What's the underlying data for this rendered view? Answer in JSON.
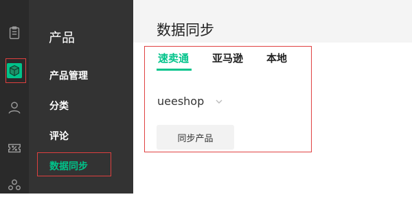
{
  "rail": {
    "icons": [
      "clipboard-icon",
      "cube-icon",
      "user-icon",
      "discount-icon",
      "people-icon"
    ],
    "active_icon": "cube-icon"
  },
  "sidebar": {
    "section_title": "产品",
    "items": [
      {
        "label": "产品管理"
      },
      {
        "label": "分类"
      },
      {
        "label": "评论"
      },
      {
        "label": "数据同步"
      }
    ]
  },
  "page": {
    "title": "数据同步",
    "tabs": [
      {
        "label": "速卖通"
      },
      {
        "label": "亚马逊"
      },
      {
        "label": "本地"
      }
    ],
    "store_select": {
      "value": "ueeshop"
    },
    "sync_button": "同步产品"
  },
  "colors": {
    "accent": "#00c38a",
    "highlight": "#e0403f",
    "rail_bg": "#2a2a2a",
    "sidebar_bg": "#333333",
    "active_icon_bg": "#00c38a"
  }
}
